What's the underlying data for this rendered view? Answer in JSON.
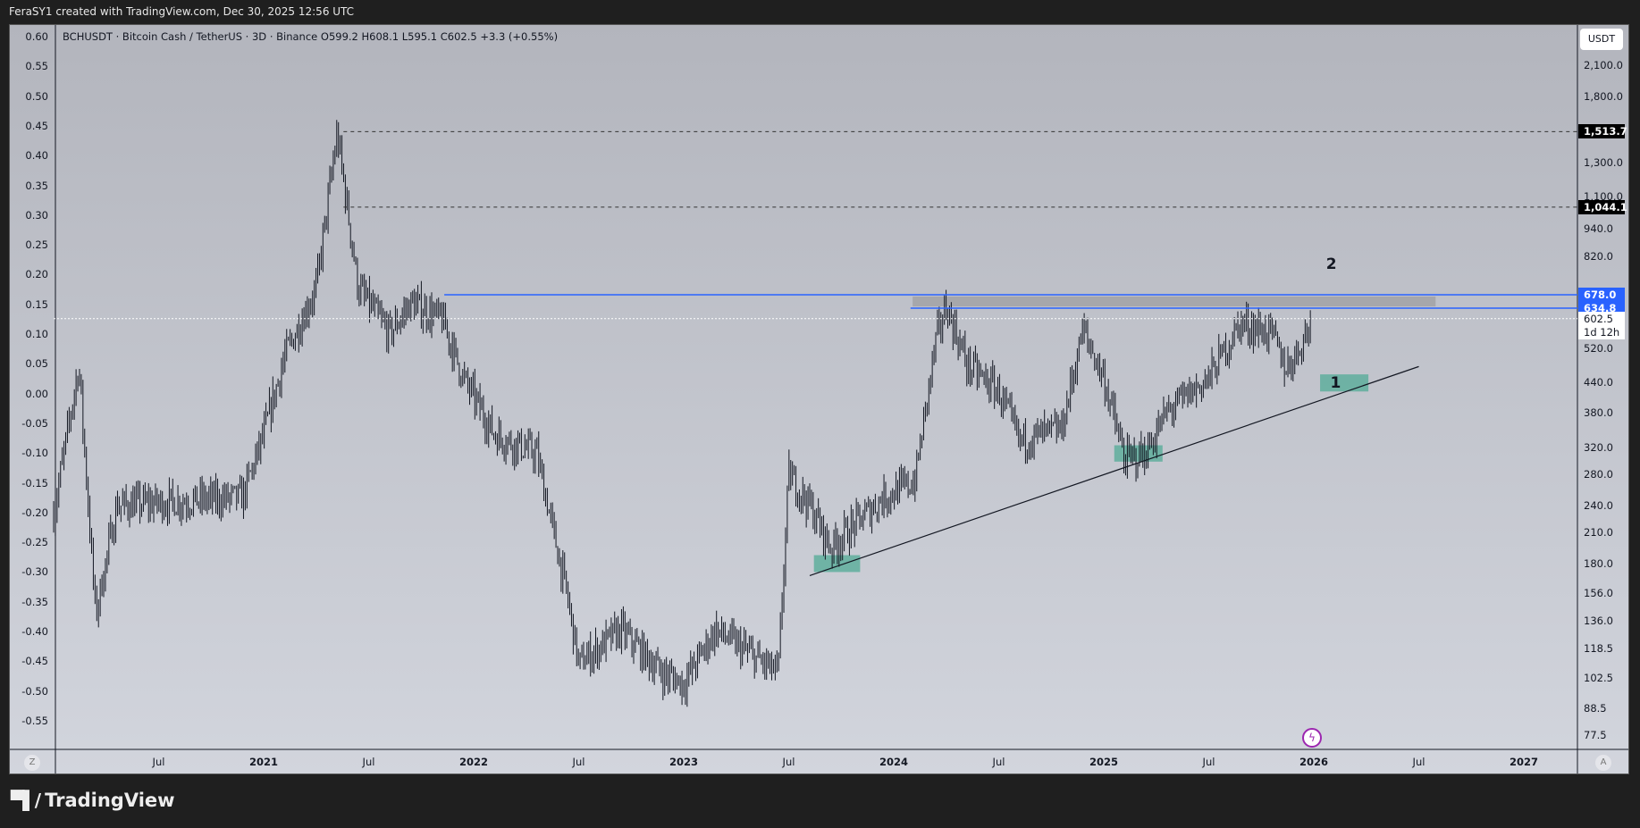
{
  "header": {
    "attribution": "FeraSY1 created with TradingView.com, Dec 30, 2025 12:56 UTC"
  },
  "legend": {
    "text": "BCHUSDT · Bitcoin Cash / TetherUS · 3D · Binance  O599.2  H608.1  L595.1  C602.5  +3.3 (+0.55%)"
  },
  "currency_button": "USDT",
  "scale_buttons": {
    "left": "Z",
    "right": "A"
  },
  "footer": {
    "brand": "TradingView"
  },
  "colors": {
    "accent": "#2962ff",
    "zone_green": "#5fae9c",
    "zone_gray": "#a0a0a4"
  },
  "chart_data": {
    "type": "ohlc",
    "symbol": "BCHUSDT",
    "timeframe": "3D",
    "exchange": "Binance",
    "last": {
      "open": 599.2,
      "high": 608.1,
      "low": 595.1,
      "close": 602.5,
      "change": 3.3,
      "change_pct": 0.55,
      "countdown": "1d 12h"
    },
    "y_scale": "log",
    "ylim": [
      74,
      2350
    ],
    "xlim": [
      2020.0,
      2027.25
    ],
    "left_axis_ticks": [
      "0.60",
      "0.55",
      "0.50",
      "0.45",
      "0.40",
      "0.35",
      "0.30",
      "0.25",
      "0.20",
      "0.15",
      "0.10",
      "0.05",
      "0.00",
      "-0.05",
      "-0.10",
      "-0.15",
      "-0.20",
      "-0.25",
      "-0.30",
      "-0.35",
      "-0.40",
      "-0.45",
      "-0.50",
      "-0.55"
    ],
    "right_axis_ticks": [
      [
        "2,100.0",
        2100
      ],
      [
        "1,800.0",
        1800
      ],
      [
        "1,300.0",
        1300
      ],
      [
        "1,100.0",
        1100
      ],
      [
        "940.0",
        940
      ],
      [
        "820.0",
        820
      ],
      [
        "520.0",
        520
      ],
      [
        "440.0",
        440
      ],
      [
        "380.0",
        380
      ],
      [
        "320.0",
        320
      ],
      [
        "280.0",
        280
      ],
      [
        "240.0",
        240
      ],
      [
        "210.0",
        210
      ],
      [
        "180.0",
        180
      ],
      [
        "156.0",
        156
      ],
      [
        "136.0",
        136
      ],
      [
        "118.5",
        118.5
      ],
      [
        "102.5",
        102.5
      ],
      [
        "88.5",
        88.5
      ],
      [
        "77.5",
        77.5
      ]
    ],
    "x_ticks": [
      [
        "Jul",
        2020.5,
        false
      ],
      [
        "2021",
        2021,
        true
      ],
      [
        "Jul",
        2021.5,
        false
      ],
      [
        "2022",
        2022,
        true
      ],
      [
        "Jul",
        2022.5,
        false
      ],
      [
        "2023",
        2023,
        true
      ],
      [
        "Jul",
        2023.5,
        false
      ],
      [
        "2024",
        2024,
        true
      ],
      [
        "Jul",
        2024.5,
        false
      ],
      [
        "2025",
        2025,
        true
      ],
      [
        "Jul",
        2025.5,
        false
      ],
      [
        "2026",
        2026,
        true
      ],
      [
        "Jul",
        2026.5,
        false
      ],
      [
        "2027",
        2027,
        true
      ]
    ],
    "price_path": [
      [
        2020.0,
        230
      ],
      [
        2020.12,
        480
      ],
      [
        2020.2,
        140
      ],
      [
        2020.3,
        240
      ],
      [
        2020.6,
        245
      ],
      [
        2020.9,
        250
      ],
      [
        2021.0,
        340
      ],
      [
        2021.1,
        500
      ],
      [
        2021.25,
        700
      ],
      [
        2021.35,
        1500
      ],
      [
        2021.45,
        700
      ],
      [
        2021.6,
        560
      ],
      [
        2021.7,
        650
      ],
      [
        2021.85,
        600
      ],
      [
        2021.95,
        450
      ],
      [
        2022.1,
        340
      ],
      [
        2022.3,
        310
      ],
      [
        2022.45,
        150
      ],
      [
        2022.5,
        110
      ],
      [
        2022.7,
        130
      ],
      [
        2022.9,
        105
      ],
      [
        2023.0,
        100
      ],
      [
        2023.15,
        130
      ],
      [
        2023.45,
        105
      ],
      [
        2023.5,
        280
      ],
      [
        2023.6,
        240
      ],
      [
        2023.7,
        195
      ],
      [
        2023.95,
        250
      ],
      [
        2024.1,
        270
      ],
      [
        2024.2,
        540
      ],
      [
        2024.25,
        640
      ],
      [
        2024.35,
        480
      ],
      [
        2024.5,
        420
      ],
      [
        2024.6,
        330
      ],
      [
        2024.8,
        350
      ],
      [
        2024.9,
        570
      ],
      [
        2025.0,
        450
      ],
      [
        2025.1,
        300
      ],
      [
        2025.2,
        310
      ],
      [
        2025.3,
        380
      ],
      [
        2025.5,
        450
      ],
      [
        2025.65,
        590
      ],
      [
        2025.8,
        560
      ],
      [
        2025.87,
        470
      ],
      [
        2025.94,
        530
      ],
      [
        2025.99,
        602.5
      ]
    ],
    "horizontal_levels": [
      {
        "label": "1,513.7",
        "price": 1513.7,
        "style": "dashed",
        "from": 2021.38,
        "badge": "black"
      },
      {
        "label": "1,044.1",
        "price": 1044.1,
        "style": "dashed",
        "from": 2021.38,
        "badge": "black"
      },
      {
        "label": "678.0",
        "price": 678.0,
        "style": "solid",
        "from": 2021.86,
        "badge": "blue"
      },
      {
        "label": "634.8",
        "price": 634.8,
        "style": "solid",
        "from": 2024.08,
        "badge": "blue"
      },
      {
        "label": "602.5",
        "price": 602.5,
        "style": "dotted",
        "from": 2020.0,
        "badge": "white"
      }
    ],
    "resistance_zone": {
      "from": 2024.09,
      "to": 2026.58,
      "top": 672,
      "bottom": 640
    },
    "trendline": {
      "from": [
        2023.6,
        170
      ],
      "to": [
        2026.5,
        476
      ]
    },
    "support_zones": [
      {
        "from": 2023.62,
        "to": 2023.84,
        "top": 188,
        "bottom": 173
      },
      {
        "from": 2025.05,
        "to": 2025.28,
        "top": 323,
        "bottom": 298
      },
      {
        "from": 2026.03,
        "to": 2026.26,
        "top": 458,
        "bottom": 421
      }
    ],
    "annotations": [
      {
        "text": "2",
        "x": 2026.08,
        "price": 780
      },
      {
        "text": "1",
        "x": 2026.1,
        "price": 435
      }
    ]
  }
}
